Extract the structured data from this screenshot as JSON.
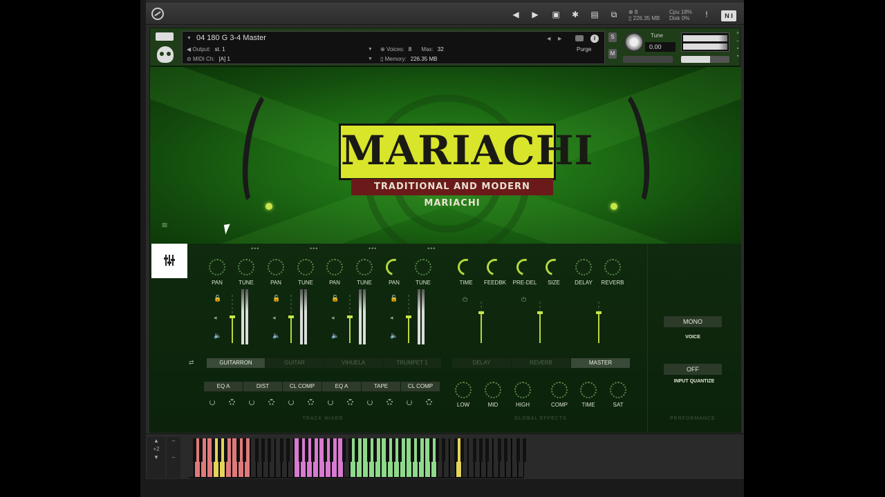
{
  "toolbar": {
    "stats_line1": "⊕ 8",
    "stats_line2": "▯ 226.35 MB",
    "cpu_label": "Cpu 18%",
    "disk_label": "Disk 0%",
    "ni_label": "N I"
  },
  "instrument": {
    "name": "04 180 G 3-4 Master",
    "output_label": "Output:",
    "output_value": "st. 1",
    "midi_label": "MIDI Ch:",
    "midi_value": "[A] 1",
    "voices_label": "Voices:",
    "voices_value": "8",
    "max_label": "Max:",
    "max_value": "32",
    "memory_label": "Memory:",
    "memory_value": "226.35 MB",
    "purge_label": "Purge",
    "solo_label": "S",
    "mute_label": "M",
    "tune_label": "Tune",
    "tune_value": "0.00"
  },
  "hero": {
    "title": "MARIACHI",
    "subtitle": "TRADITIONAL AND MODERN MARIACHI"
  },
  "track_mixer": {
    "knob_labels": [
      "PAN",
      "TUNE",
      "PAN",
      "TUNE",
      "PAN",
      "TUNE",
      "PAN",
      "TUNE"
    ],
    "tracks": [
      "GUITARRON",
      "GUITAR",
      "VIHUELA",
      "TRUMPET 1"
    ],
    "active_track": "GUITARRON",
    "fx_buttons": [
      "EQ A",
      "DIST",
      "CL COMP",
      "EQ A",
      "TAPE",
      "CL COMP"
    ],
    "section_label": "TRACK MIXER"
  },
  "global_effects": {
    "knob_labels_top": [
      "TIME",
      "FEEDBK",
      "PRE-DEL",
      "SIZE",
      "DELAY",
      "REVERB"
    ],
    "tabs": [
      "DELAY",
      "REVERB",
      "MASTER"
    ],
    "active_tab": "MASTER",
    "knob_labels_bottom": [
      "LOW",
      "MID",
      "HIGH",
      "COMP",
      "TIME",
      "SAT"
    ],
    "section_label": "GLOBAL EFFECTS"
  },
  "performance": {
    "voice_button": "MONO",
    "voice_label": "VOICE",
    "quantize_button": "OFF",
    "quantize_label": "INPUT QUANTIZE",
    "section_label": "PERFORMANCE"
  },
  "keyboard": {
    "octave_label": "+2",
    "key_colors": {
      "red": "#e07a7a",
      "yellow": "#e4d45a",
      "pink": "#d77ad0",
      "green": "#8ed98a",
      "white": "#2a2a2a"
    }
  },
  "colors": {
    "accent": "#b7d83e",
    "logo_bg": "#d8e52b",
    "subtitle_bg": "#6b1a1a"
  }
}
